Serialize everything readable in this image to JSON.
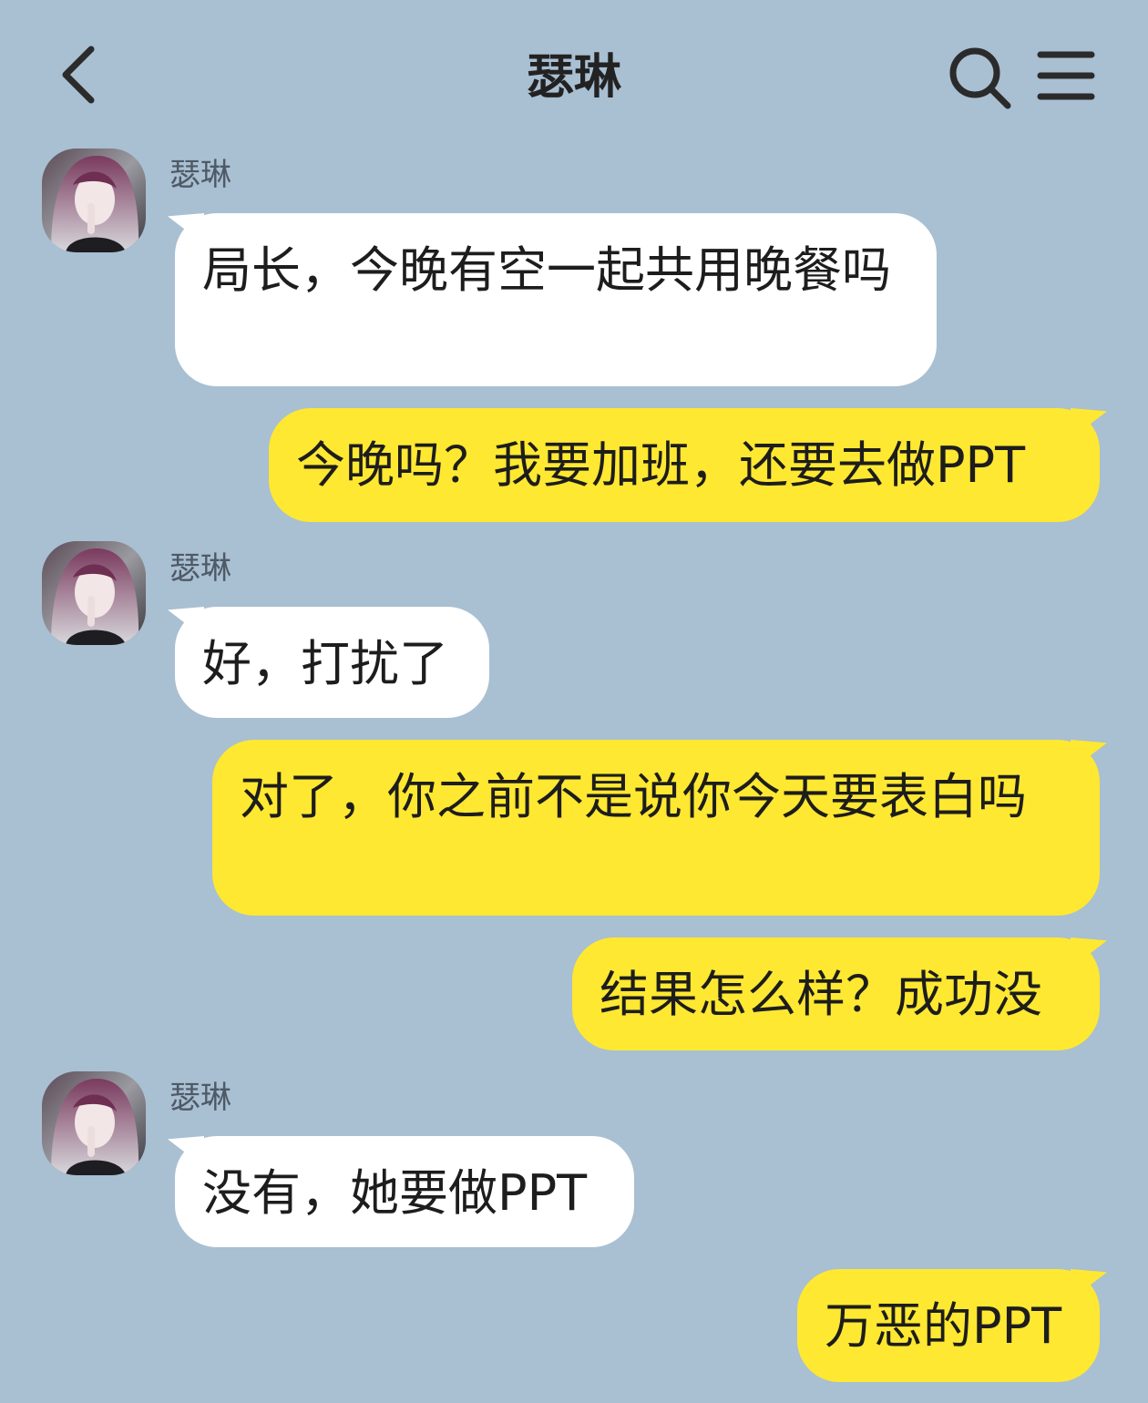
{
  "header": {
    "title": "瑟琳",
    "back_icon": "chevron-left-icon",
    "search_icon": "search-icon",
    "menu_icon": "hamburger-menu-icon"
  },
  "contact": {
    "name": "瑟琳",
    "avatar": "anime-girl-avatar"
  },
  "messages": [
    {
      "from": "contact",
      "sender": "瑟琳",
      "text": "局长，今晚有空一起共用晚餐吗"
    },
    {
      "from": "me",
      "text": "今晚吗？我要加班，还要去做PPT"
    },
    {
      "from": "contact",
      "sender": "瑟琳",
      "text": "好，打扰了"
    },
    {
      "from": "me",
      "text": "对了，你之前不是说你今天要表白吗"
    },
    {
      "from": "me",
      "text": "结果怎么样？成功没"
    },
    {
      "from": "contact",
      "sender": "瑟琳",
      "text": "没有，她要做PPT"
    },
    {
      "from": "me",
      "text": "万恶的PPT"
    }
  ],
  "colors": {
    "background": "#a9bfd2",
    "incoming_bubble": "#ffffff",
    "outgoing_bubble": "#ffe831",
    "sender_name": "#4e5a66"
  }
}
